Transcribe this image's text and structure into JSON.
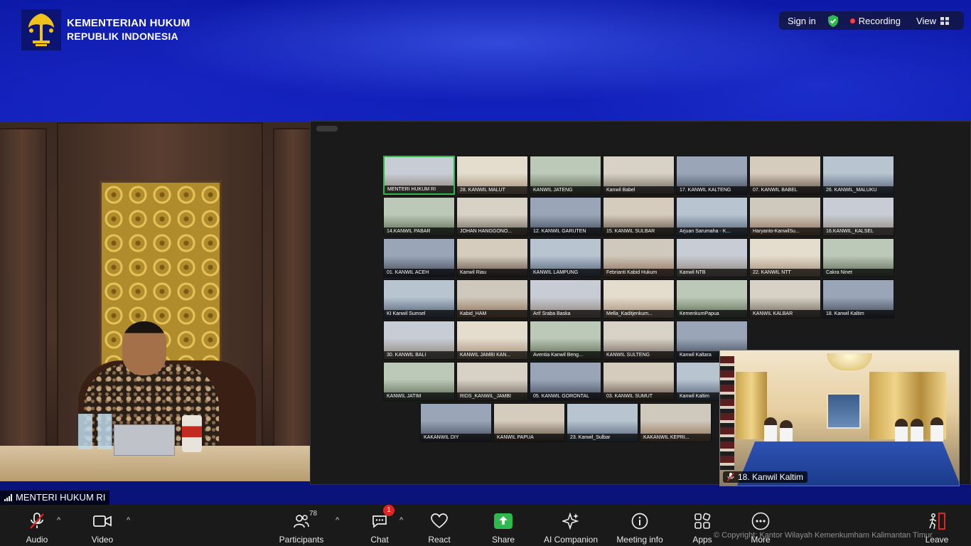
{
  "logo": {
    "line1": "KEMENTERIAN HUKUM",
    "line2": "REPUBLIK INDONESIA"
  },
  "top_controls": {
    "sign_in": "Sign in",
    "recording": "Recording",
    "view": "View",
    "shield_color": "#2fb84e",
    "recording_dot_color": "#ff3b3b"
  },
  "speaker": {
    "name": "MENTERI HUKUM RI"
  },
  "gallery": {
    "rows": [
      [
        "MENTERI HUKUM RI",
        "28. KANWIL MALUT",
        "KANWIL JATENG",
        "Kanwil Babel",
        "17. KANWIL KALTENG",
        "07. KANWIL BABEL",
        "26. KANWIL_MALUKU"
      ],
      [
        "14.KANWIL PABAR",
        "JOHAN HANGGONO...",
        "12. KANWIL GARUTEN",
        "15. KANWIL SULBAR",
        "Arjuan Sarumaha - K...",
        "Haryanto-KanwilSu...",
        "16.KANWIL_KALSEL"
      ],
      [
        "01. KANWIL ACEH",
        "Kanwil Riau",
        "KANWIL LAMPUNG",
        "Febrianti Kabid Hukum",
        "Kanwil NTB",
        "22. KANWIL NTT",
        "Cakra Ninet"
      ],
      [
        "KI Kanwil Sumsel",
        "Kabid_HAM",
        "Arif Sraba Baska",
        "Mella_Kaditjenkum...",
        "KemenkumPapua",
        "KANWIL KALBAR",
        "18. Kanwil Kaltim"
      ],
      [
        "30. KANWIL BALI",
        "KANWIL JAMBI KAN...",
        "Aventia Kanwil Beng...",
        "KANWIL SULTENG",
        "Kanwil Kaltara",
        "",
        ""
      ],
      [
        "KANWIL JATIM",
        "RIDS_KANWIL_JAMBI",
        "05. KANWIL GORONTAL",
        "03. KANWIL SUMUT",
        "Kanwil Kaltim",
        "",
        ""
      ]
    ],
    "last_row": [
      "KAKANWIL DIY",
      "KANWIL PAPUA",
      "23. Kanwil_Sulbar",
      "KAKANWIL KEPRI..."
    ]
  },
  "pip": {
    "name": "18. Kanwil Kaltim"
  },
  "toolbar": {
    "audio": "Audio",
    "video": "Video",
    "participants": "Participants",
    "participants_count": "78",
    "chat": "Chat",
    "chat_badge": "1",
    "react": "React",
    "share": "Share",
    "share_color": "#2fb84e",
    "ai_companion": "AI Companion",
    "meeting_info": "Meeting info",
    "apps": "Apps",
    "more": "More",
    "leave": "Leave",
    "leave_color": "#e02424"
  },
  "copyright": "© Copyright: Kantor Wilayah Kemenkumham Kalimantan Timur"
}
